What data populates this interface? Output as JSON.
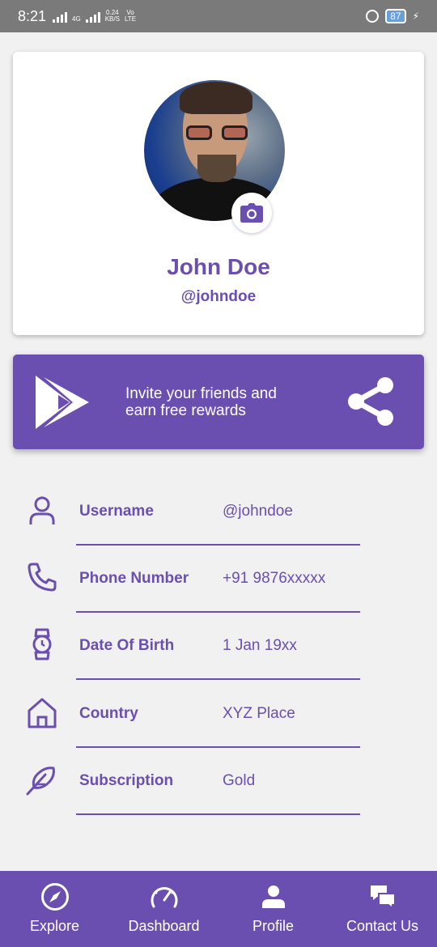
{
  "status_bar": {
    "time": "8:21",
    "network_small": "4G",
    "speed": "0.24",
    "speed_unit": "KB/S",
    "volte_top": "Vo",
    "volte_bottom": "LTE",
    "battery": "87"
  },
  "profile": {
    "name": "John Doe",
    "handle": "@johndoe",
    "avatar_icon": "avatar-photo",
    "camera_icon": "camera-icon"
  },
  "invite": {
    "text_line1": "Invite your friends and",
    "text_line2": "earn free rewards",
    "left_icon": "play-store-icon",
    "right_icon": "share-icon"
  },
  "info_rows": [
    {
      "icon": "user-icon",
      "label": "Username",
      "value": "@johndoe"
    },
    {
      "icon": "phone-icon",
      "label": "Phone Number",
      "value": "+91 9876xxxxx"
    },
    {
      "icon": "watch-icon",
      "label": "Date Of Birth",
      "value": "1 Jan 19xx"
    },
    {
      "icon": "home-icon",
      "label": "Country",
      "value": "XYZ Place"
    },
    {
      "icon": "feather-icon",
      "label": "Subscription",
      "value": "Gold"
    }
  ],
  "bottom_nav": [
    {
      "icon": "compass-icon",
      "label": "Explore"
    },
    {
      "icon": "speedometer-icon",
      "label": "Dashboard"
    },
    {
      "icon": "person-icon",
      "label": "Profile"
    },
    {
      "icon": "chat-icon",
      "label": "Contact Us"
    }
  ],
  "colors": {
    "accent": "#6a4fb0",
    "background": "#f1f1f1",
    "status_bar": "#7a7a7a"
  }
}
